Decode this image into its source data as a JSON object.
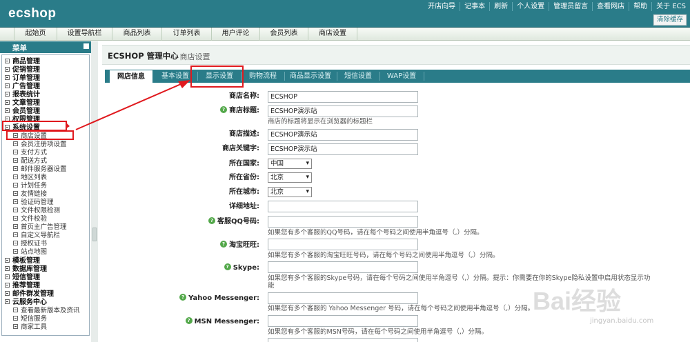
{
  "header": {
    "logo": "ecshop",
    "links": [
      "开店向导",
      "记事本",
      "刷新",
      "个人设置",
      "管理员留言",
      "查看网店",
      "帮助",
      "关于 ECS"
    ],
    "clear_cache": "清除缓存"
  },
  "nav": {
    "items": [
      "起始页",
      "设置导航栏",
      "商品列表",
      "订单列表",
      "用户评论",
      "会员列表",
      "商店设置"
    ]
  },
  "sidebar": {
    "title": "菜单",
    "groups_top": [
      "商品管理",
      "促销管理",
      "订单管理",
      "广告管理",
      "报表统计",
      "文章管理",
      "会员管理",
      "权限管理",
      "系统设置"
    ],
    "system_items": [
      "商店设置",
      "会员注册项设置",
      "支付方式",
      "配送方式",
      "邮件服务器设置",
      "地区列表",
      "计划任务",
      "友情链接",
      "验证码管理",
      "文件权限检测",
      "文件校验",
      "首页主广告管理",
      "自定义导航栏",
      "授权证书",
      "站点地图"
    ],
    "groups_bottom": [
      "模板管理",
      "数据库管理",
      "短信管理",
      "推荐管理",
      "邮件群发管理",
      "云服务中心"
    ],
    "cloud_items": [
      "查看最新版本及资讯",
      "短信服务",
      "商家工具"
    ]
  },
  "main": {
    "title": "ECSHOP 管理中心",
    "subtitle": "- 商店设置",
    "tabs": [
      "网店信息",
      "基本设置",
      "显示设置",
      "购物流程",
      "商品显示设置",
      "短信设置",
      "WAP设置"
    ],
    "active_tab": "网店信息"
  },
  "form": {
    "shop_name": {
      "label": "商店名称:",
      "value": "ECSHOP"
    },
    "shop_title": {
      "label": "商店标题:",
      "value": "ECSHOP演示站",
      "hint": "商店的标题将显示在浏览器的标题栏"
    },
    "shop_desc": {
      "label": "商店描述:",
      "value": "ECSHOP演示站"
    },
    "shop_keywords": {
      "label": "商店关键字:",
      "value": "ECSHOP演示站"
    },
    "country": {
      "label": "所在国家:",
      "value": "中国"
    },
    "province": {
      "label": "所在省份:",
      "value": "北京"
    },
    "city": {
      "label": "所在城市:",
      "value": "北京"
    },
    "address": {
      "label": "详细地址:",
      "value": ""
    },
    "qq": {
      "label": "客服QQ号码:",
      "value": "",
      "hint": "如果您有多个客服的QQ号码，请在每个号码之间使用半角逗号（,）分隔。"
    },
    "wangwang": {
      "label": "淘宝旺旺:",
      "value": "",
      "hint": "如果您有多个客服的淘宝旺旺号码，请在每个号码之间使用半角逗号（,）分隔。"
    },
    "skype": {
      "label": "Skype:",
      "value": "",
      "hint": "如果您有多个客服的Skype号码，请在每个号码之间使用半角逗号（,）分隔。提示：你需要在你的Skype隐私设置中启用状态显示功",
      "hint2": "能"
    },
    "yahoo": {
      "label": "Yahoo Messenger:",
      "value": "",
      "hint": "如果您有多个客服的 Yahoo Messenger 号码，请在每个号码之间使用半角逗号（,）分隔。"
    },
    "msn": {
      "label": "MSN Messenger:",
      "value": "",
      "hint": "如果您有多个客服的MSN号码，请在每个号码之间使用半角逗号（,）分隔。"
    }
  },
  "watermark": {
    "logo": "Bai经验",
    "url": "jingyan.baidu.com"
  },
  "colors": {
    "header": "#2a7c89",
    "annotation": "#e0191e",
    "help_icon": "#53a84a"
  }
}
